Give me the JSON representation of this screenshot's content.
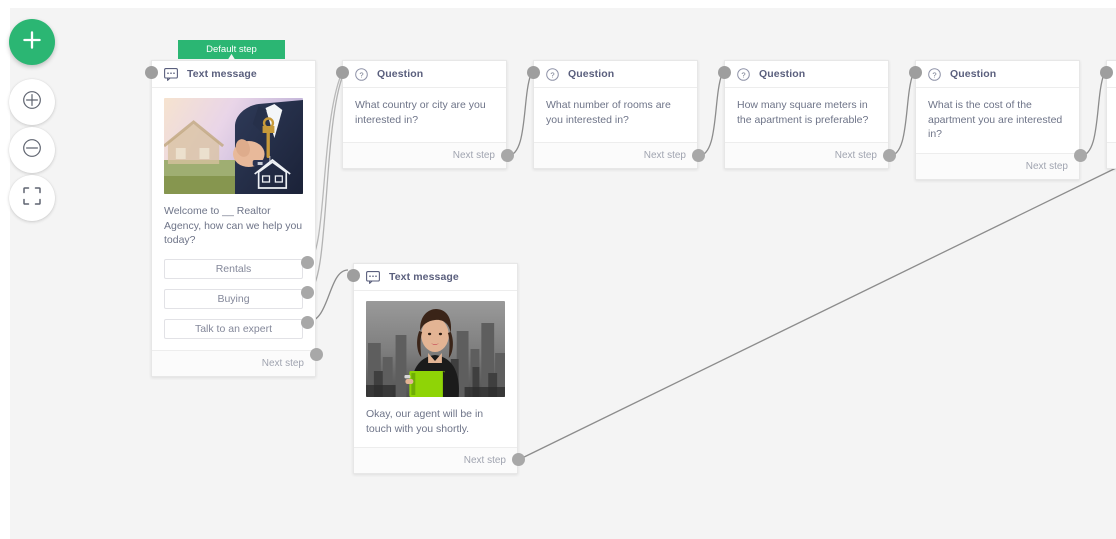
{
  "toolbar": {
    "buttons": [
      {
        "name": "add-step-button",
        "icon": "plus-icon",
        "label": "Add step"
      },
      {
        "name": "zoom-in-button",
        "icon": "zoom-in-icon",
        "label": "Zoom in"
      },
      {
        "name": "zoom-out-button",
        "icon": "zoom-out-icon",
        "label": "Zoom out"
      },
      {
        "name": "fit-screen-button",
        "icon": "fit-screen-icon",
        "label": "Fit to screen"
      }
    ]
  },
  "colors": {
    "accent_green": "#2bb673",
    "canvas": "#f4f4f4",
    "card_border": "#e7e7e7",
    "connector": "#8c8c8c",
    "dot": "#a8a8a8",
    "title_text": "#5a5f7d",
    "body_text": "#6e7488",
    "muted_text": "#a0a4b0"
  },
  "badge": {
    "label": "Default step"
  },
  "labels": {
    "next_step": "Next step",
    "text_message": "Text message",
    "question": "Question"
  },
  "nodes": [
    {
      "id": "welcome",
      "type": "text-message",
      "header": "Text message",
      "image": "realtor-holding-house-key",
      "text": "Welcome to __ Realtor Agency, how can we help you today?",
      "choices": [
        {
          "label": "Rentals"
        },
        {
          "label": "Buying"
        },
        {
          "label": "Talk to an expert"
        }
      ],
      "footer": "Next step"
    },
    {
      "id": "q-country",
      "type": "question",
      "header": "Question",
      "text": "What country or city are you interested in?",
      "footer": "Next step"
    },
    {
      "id": "q-rooms",
      "type": "question",
      "header": "Question",
      "text": "What number of rooms are you interested in?",
      "footer": "Next step"
    },
    {
      "id": "q-meters",
      "type": "question",
      "header": "Question",
      "text": "How many square meters in the apartment is preferable?",
      "footer": "Next step"
    },
    {
      "id": "q-cost",
      "type": "question",
      "header": "Question",
      "text": "What is the cost of the apartment you are interested in?",
      "footer": "Next step"
    },
    {
      "id": "agent",
      "type": "text-message",
      "header": "Text message",
      "image": "businesswoman-with-green-folder",
      "text": "Okay, our agent will be in touch with you shortly.",
      "footer": "Next step"
    }
  ]
}
